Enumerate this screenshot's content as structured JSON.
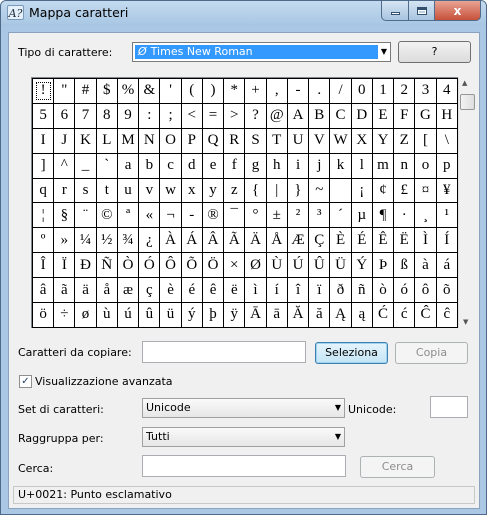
{
  "window": {
    "title": "Mappa caratteri",
    "icon_text": "A?",
    "minimize_label": "_",
    "maximize_label": "□",
    "close_label": "x"
  },
  "font_row": {
    "label": "Tipo di carattere:",
    "font_name": "Times New Roman",
    "font_icon": "Ø",
    "help_button": "?"
  },
  "grid": {
    "selected_index": 0,
    "rows": [
      [
        "!",
        "\"",
        "#",
        "$",
        "%",
        "&",
        "'",
        "(",
        ")",
        "*",
        "+",
        ",",
        "-",
        ".",
        "/",
        "0",
        "1",
        "2",
        "3",
        "4"
      ],
      [
        "5",
        "6",
        "7",
        "8",
        "9",
        ":",
        ";",
        "<",
        "=",
        ">",
        "?",
        "@",
        "A",
        "B",
        "C",
        "D",
        "E",
        "F",
        "G",
        "H"
      ],
      [
        "I",
        "J",
        "K",
        "L",
        "M",
        "N",
        "O",
        "P",
        "Q",
        "R",
        "S",
        "T",
        "U",
        "V",
        "W",
        "X",
        "Y",
        "Z",
        "[",
        "\\"
      ],
      [
        "]",
        "^",
        "_",
        "`",
        "a",
        "b",
        "c",
        "d",
        "e",
        "f",
        "g",
        "h",
        "i",
        "j",
        "k",
        "l",
        "m",
        "n",
        "o",
        "p"
      ],
      [
        "q",
        "r",
        "s",
        "t",
        "u",
        "v",
        "w",
        "x",
        "y",
        "z",
        "{",
        "|",
        "}",
        "~",
        " ",
        "¡",
        "¢",
        "£",
        "¤",
        "¥"
      ],
      [
        "¦",
        "§",
        "¨",
        "©",
        "ª",
        "«",
        "¬",
        "-",
        "®",
        "¯",
        "°",
        "±",
        "²",
        "³",
        "´",
        "µ",
        "¶",
        "·",
        "¸",
        "¹"
      ],
      [
        "º",
        "»",
        "¼",
        "½",
        "¾",
        "¿",
        "À",
        "Á",
        "Â",
        "Ã",
        "Ä",
        "Å",
        "Æ",
        "Ç",
        "È",
        "É",
        "Ê",
        "Ë",
        "Ì",
        "Í"
      ],
      [
        "Î",
        "Ï",
        "Ð",
        "Ñ",
        "Ò",
        "Ó",
        "Ô",
        "Õ",
        "Ö",
        "×",
        "Ø",
        "Ù",
        "Ú",
        "Û",
        "Ü",
        "Ý",
        "Þ",
        "ß",
        "à",
        "á"
      ],
      [
        "â",
        "ã",
        "ä",
        "å",
        "æ",
        "ç",
        "è",
        "é",
        "ê",
        "ë",
        "ì",
        "í",
        "î",
        "ï",
        "ð",
        "ñ",
        "ò",
        "ó",
        "ô",
        "õ"
      ],
      [
        "ö",
        "÷",
        "ø",
        "ù",
        "ú",
        "û",
        "ü",
        "ý",
        "þ",
        "ÿ",
        "Ā",
        "ā",
        "Ă",
        "ă",
        "Ą",
        "ą",
        "Ć",
        "ć",
        "Ĉ",
        "ĉ"
      ]
    ]
  },
  "copy_row": {
    "label": "Caratteri da copiare:",
    "value": "",
    "select_button": "Seleziona",
    "copy_button": "Copia"
  },
  "advanced": {
    "checked": true,
    "label": "Visualizzazione avanzata"
  },
  "charset": {
    "label": "Set di caratteri:",
    "value": "Unicode",
    "unicode_label": "Unicode:",
    "unicode_value": ""
  },
  "group_by": {
    "label": "Raggruppa per:",
    "value": "Tutti"
  },
  "search": {
    "label": "Cerca:",
    "value": "",
    "button": "Cerca"
  },
  "status_bar": {
    "text": "U+0021: Punto esclamativo"
  },
  "colors": {
    "titlebar": "#a7c5e3",
    "selection": "#3399ff",
    "close_button": "#c7513a"
  }
}
